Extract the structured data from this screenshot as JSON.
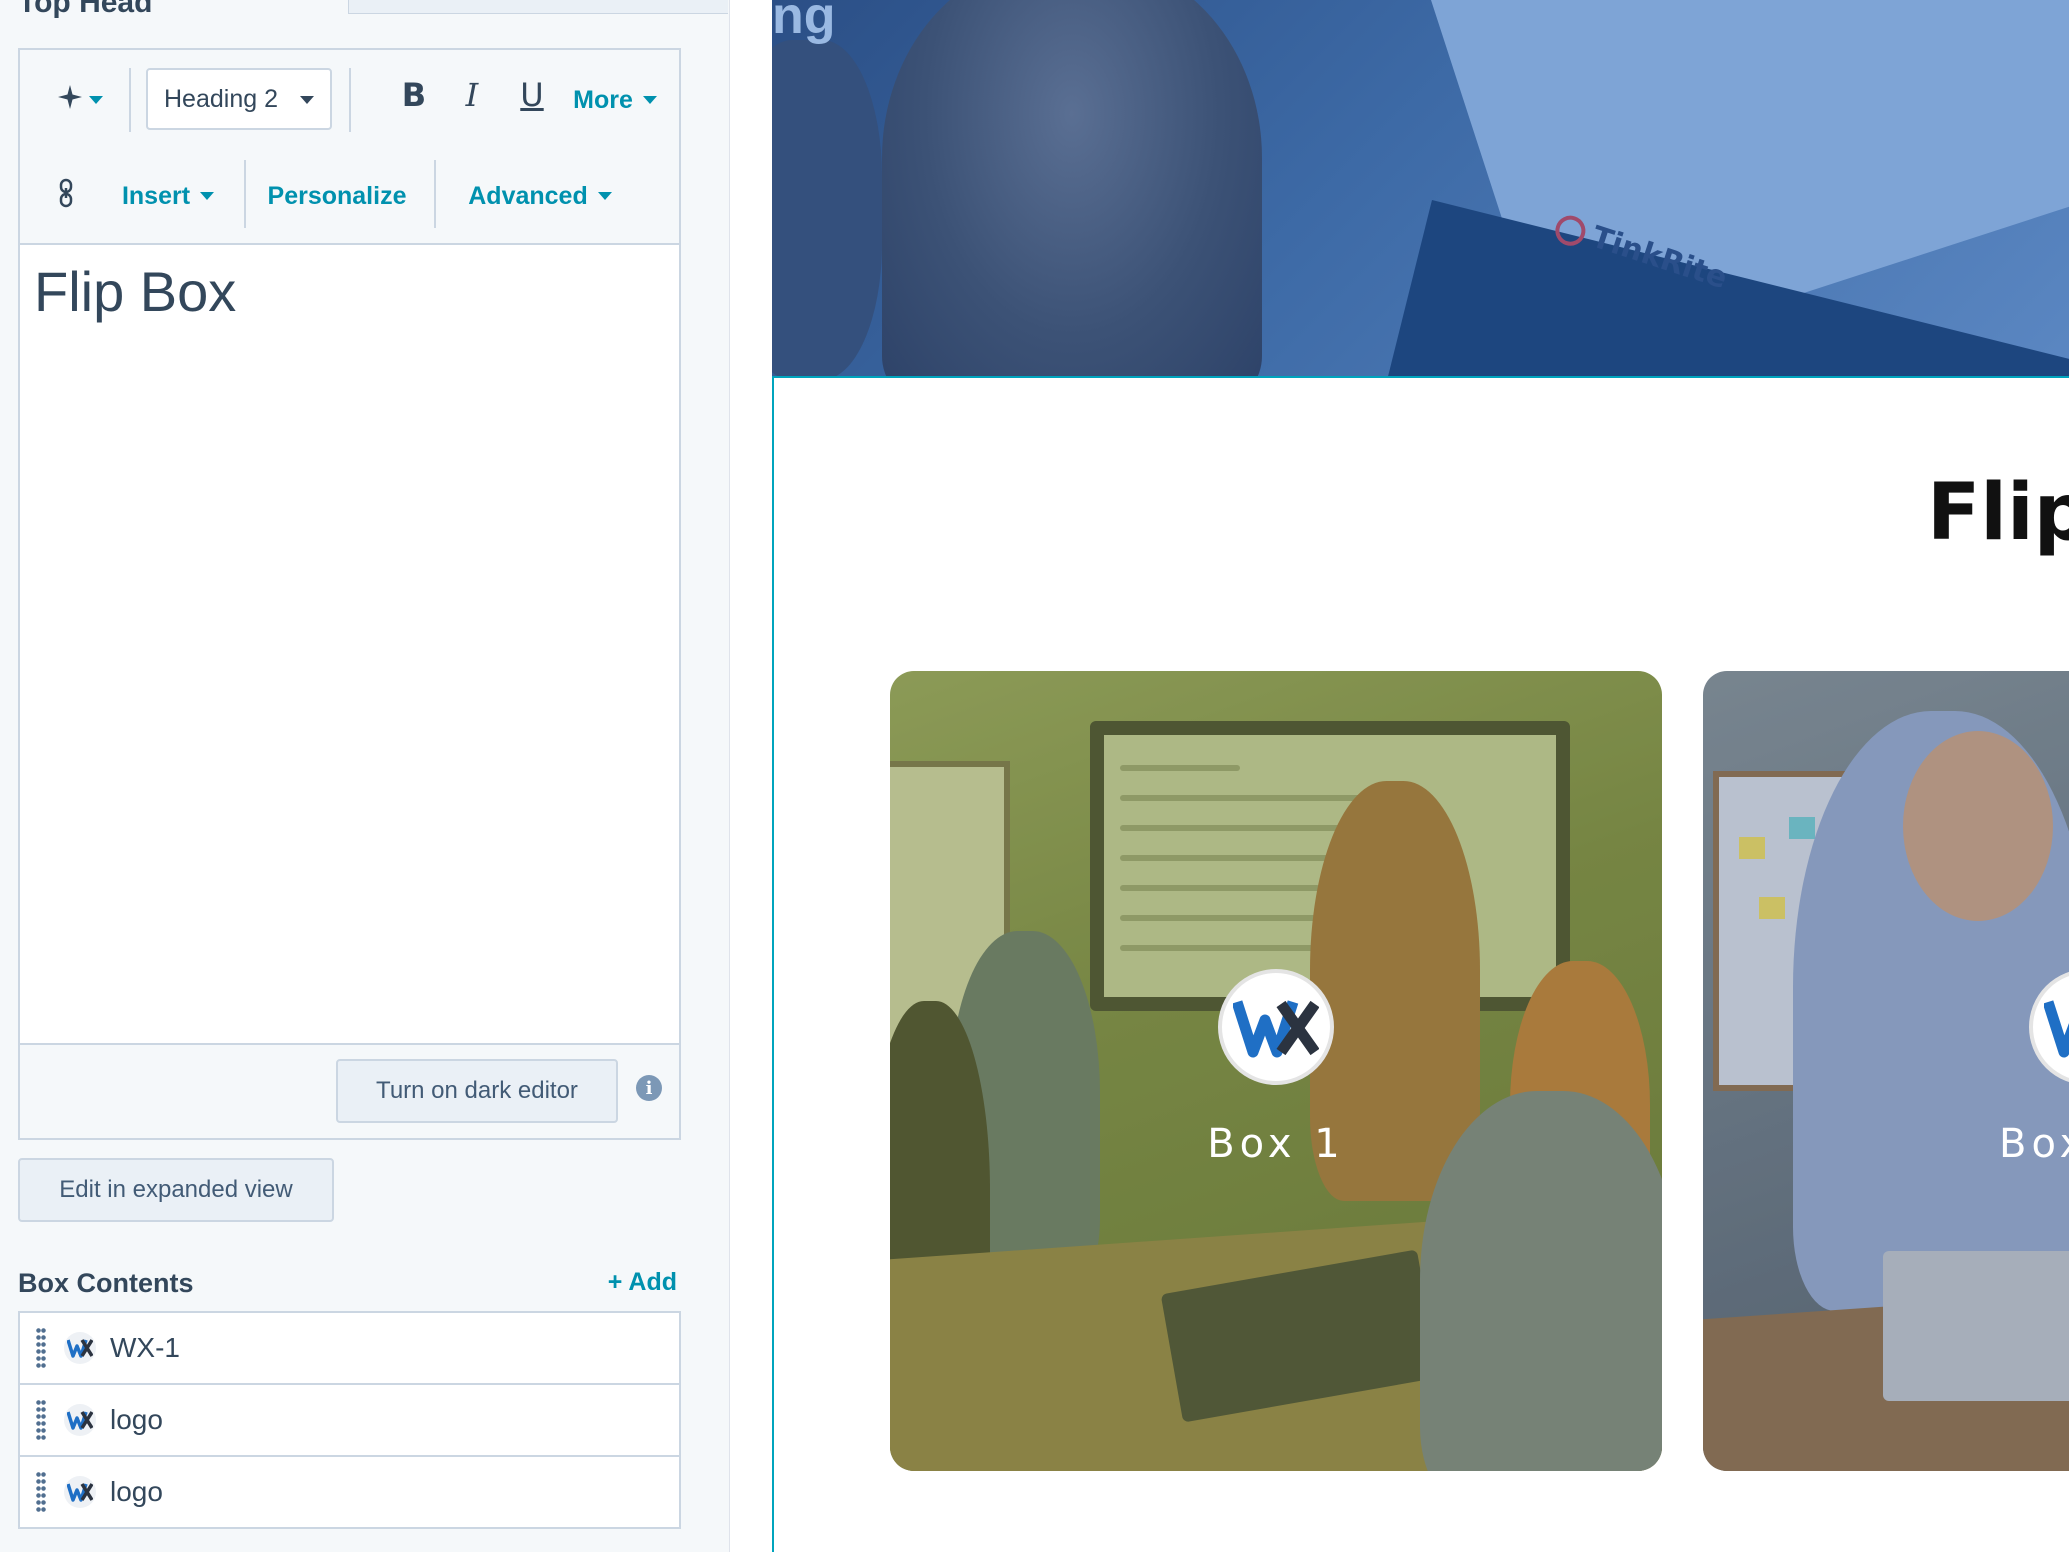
{
  "panel": {
    "heading": "Top Head",
    "toolbar": {
      "style_select": "Heading 2",
      "bold": "B",
      "italic": "I",
      "underline": "U",
      "more": "More",
      "insert": "Insert",
      "personalize": "Personalize",
      "advanced": "Advanced"
    },
    "editor_text": "Flip Box",
    "dark_editor_button": "Turn on dark editor",
    "info_icon": "i",
    "expanded_view_button": "Edit in expanded view",
    "box_contents": {
      "title": "Box Contents",
      "add": "+ Add",
      "items": [
        {
          "label": "WX-1"
        },
        {
          "label": "logo"
        },
        {
          "label": "logo"
        }
      ]
    }
  },
  "preview": {
    "hero_word": "ng",
    "hero_brand": "TinkRite",
    "title": "Flip",
    "cards": [
      {
        "label": "Box 1"
      },
      {
        "label": "Box"
      }
    ]
  },
  "colors": {
    "accent": "#0091ae",
    "text": "#33475b",
    "border": "#cbd6e2",
    "selection": "#00a4bd",
    "logo_blue": "#1f6fc5",
    "logo_dark": "#2b3340"
  }
}
